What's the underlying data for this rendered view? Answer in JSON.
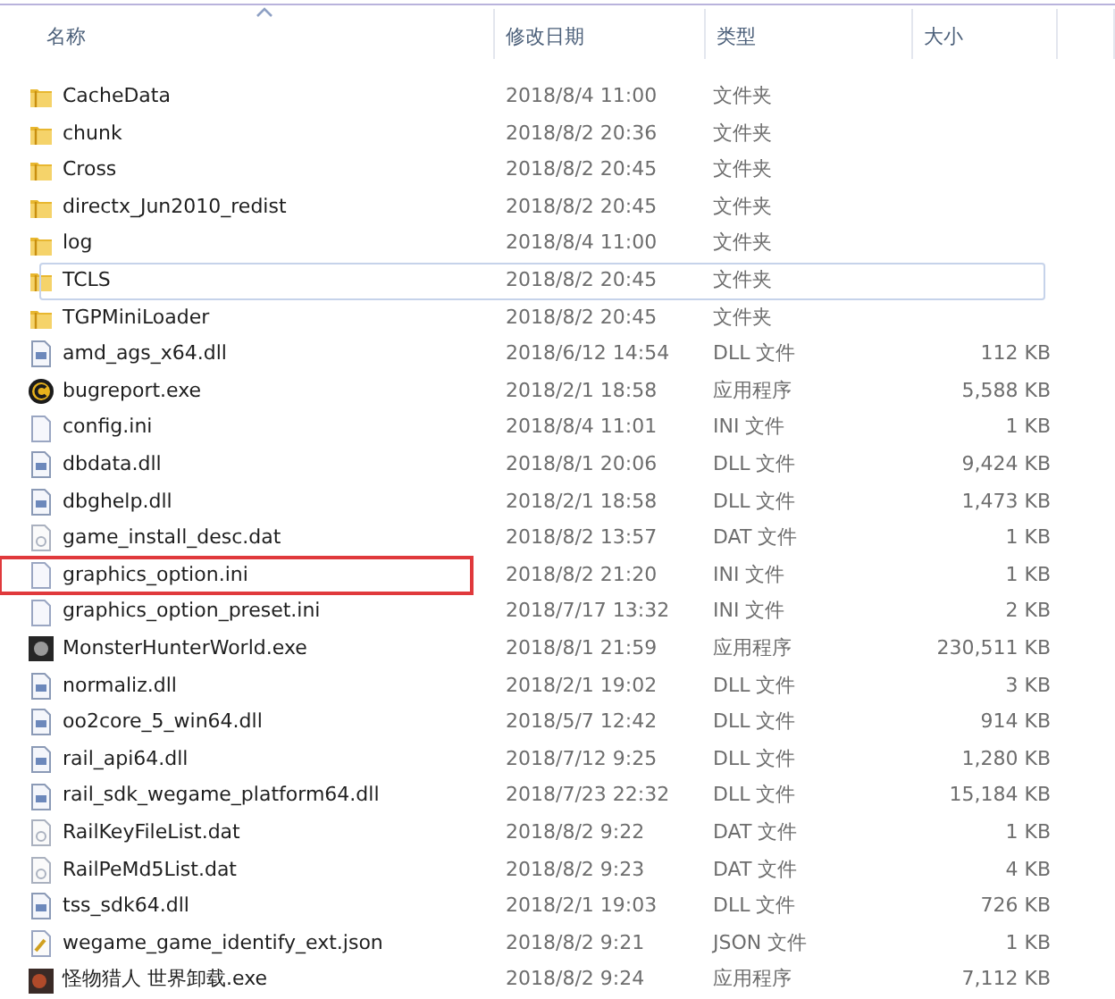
{
  "columns": [
    {
      "label": "名称",
      "sorted": true
    },
    {
      "label": "修改日期",
      "sorted": false
    },
    {
      "label": "类型",
      "sorted": false
    },
    {
      "label": "大小",
      "sorted": false
    }
  ],
  "rows": [
    {
      "name": "CacheData",
      "date": "2018/8/4 11:00",
      "type": "文件夹",
      "kind": "folder",
      "focused": false,
      "marked": false
    },
    {
      "name": "chunk",
      "date": "2018/8/2 20:36",
      "type": "文件夹",
      "kind": "folder",
      "focused": false,
      "marked": false
    },
    {
      "name": "Cross",
      "date": "2018/8/2 20:45",
      "type": "文件夹",
      "kind": "folder",
      "focused": false,
      "marked": false
    },
    {
      "name": "directx_Jun2010_redist",
      "date": "2018/8/2 20:45",
      "type": "文件夹",
      "kind": "folder",
      "focused": false,
      "marked": false
    },
    {
      "name": "log",
      "date": "2018/8/4 11:00",
      "type": "文件夹",
      "kind": "folder",
      "focused": false,
      "marked": false
    },
    {
      "name": "TCLS",
      "date": "2018/8/2 20:45",
      "type": "文件夹",
      "kind": "folder",
      "focused": true,
      "marked": false
    },
    {
      "name": "TGPMiniLoader",
      "date": "2018/8/2 20:45",
      "type": "文件夹",
      "kind": "folder",
      "focused": false,
      "marked": false
    },
    {
      "name": "amd_ags_x64.dll",
      "date": "2018/6/12 14:54",
      "type": "DLL 文件",
      "size": "112 KB",
      "kind": "dll",
      "focused": false,
      "marked": false
    },
    {
      "name": "bugreport.exe",
      "date": "2018/2/1 18:58",
      "type": "应用程序",
      "size": "5,588 KB",
      "kind": "app",
      "focused": false,
      "marked": false
    },
    {
      "name": "config.ini",
      "date": "2018/8/4 11:01",
      "type": "INI 文件",
      "size": "1 KB",
      "kind": "ini",
      "focused": false,
      "marked": false
    },
    {
      "name": "dbdata.dll",
      "date": "2018/8/1 20:06",
      "type": "DLL 文件",
      "size": "9,424 KB",
      "kind": "dll",
      "focused": false,
      "marked": false
    },
    {
      "name": "dbghelp.dll",
      "date": "2018/2/1 18:58",
      "type": "DLL 文件",
      "size": "1,473 KB",
      "kind": "dll",
      "focused": false,
      "marked": false
    },
    {
      "name": "game_install_desc.dat",
      "date": "2018/8/2 13:57",
      "type": "DAT 文件",
      "size": "1 KB",
      "kind": "dat",
      "focused": false,
      "marked": false
    },
    {
      "name": "graphics_option.ini",
      "date": "2018/8/2 21:20",
      "type": "INI 文件",
      "size": "1 KB",
      "kind": "ini",
      "focused": false,
      "marked": true
    },
    {
      "name": "graphics_option_preset.ini",
      "date": "2018/7/17 13:32",
      "type": "INI 文件",
      "size": "2 KB",
      "kind": "ini",
      "focused": false,
      "marked": false
    },
    {
      "name": "MonsterHunterWorld.exe",
      "date": "2018/8/1 21:59",
      "type": "应用程序",
      "size": "230,511 KB",
      "kind": "game",
      "focused": false,
      "marked": false
    },
    {
      "name": "normaliz.dll",
      "date": "2018/2/1 19:02",
      "type": "DLL 文件",
      "size": "3 KB",
      "kind": "dll",
      "focused": false,
      "marked": false
    },
    {
      "name": "oo2core_5_win64.dll",
      "date": "2018/5/7 12:42",
      "type": "DLL 文件",
      "size": "914 KB",
      "kind": "dll",
      "focused": false,
      "marked": false
    },
    {
      "name": "rail_api64.dll",
      "date": "2018/7/12 9:25",
      "type": "DLL 文件",
      "size": "1,280 KB",
      "kind": "dll",
      "focused": false,
      "marked": false
    },
    {
      "name": "rail_sdk_wegame_platform64.dll",
      "date": "2018/7/23 22:32",
      "type": "DLL 文件",
      "size": "15,184 KB",
      "kind": "dll",
      "focused": false,
      "marked": false
    },
    {
      "name": "RailKeyFileList.dat",
      "date": "2018/8/2 9:22",
      "type": "DAT 文件",
      "size": "1 KB",
      "kind": "dat",
      "focused": false,
      "marked": false
    },
    {
      "name": "RailPeMd5List.dat",
      "date": "2018/8/2 9:23",
      "type": "DAT 文件",
      "size": "4 KB",
      "kind": "dat",
      "focused": false,
      "marked": false
    },
    {
      "name": "tss_sdk64.dll",
      "date": "2018/2/1 19:03",
      "type": "DLL 文件",
      "size": "726 KB",
      "kind": "dll",
      "focused": false,
      "marked": false
    },
    {
      "name": "wegame_game_identify_ext.json",
      "date": "2018/8/2 9:21",
      "type": "JSON 文件",
      "size": "1 KB",
      "kind": "json",
      "focused": false,
      "marked": false
    },
    {
      "name": "怪物猎人 世界卸载.exe",
      "date": "2018/8/2 9:24",
      "type": "应用程序",
      "size": "7,112 KB",
      "kind": "uninstall",
      "focused": false,
      "marked": false
    }
  ]
}
